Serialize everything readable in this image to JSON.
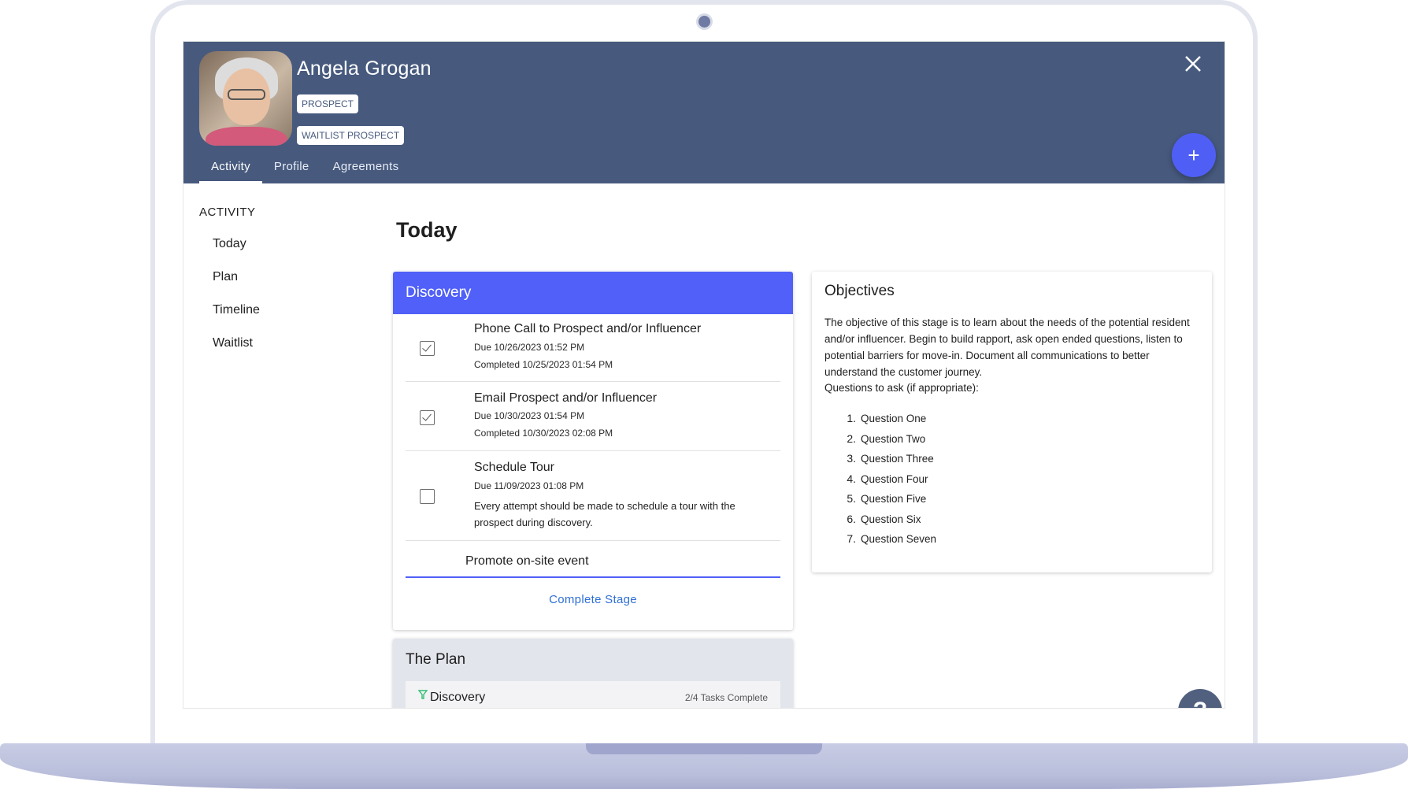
{
  "profile": {
    "name": "Angela Grogan",
    "badges": [
      "PROSPECT",
      "WAITLIST PROSPECT"
    ]
  },
  "tabs": [
    {
      "label": "Activity",
      "active": true
    },
    {
      "label": "Profile",
      "active": false
    },
    {
      "label": "Agreements",
      "active": false
    }
  ],
  "fab": {
    "icon": "plus-icon",
    "label": "+"
  },
  "sidebar": {
    "title": "ACTIVITY",
    "items": [
      "Today",
      "Plan",
      "Timeline",
      "Waitlist"
    ]
  },
  "main": {
    "title": "Today"
  },
  "discovery": {
    "title": "Discovery",
    "tasks": [
      {
        "title": "Phone Call to Prospect and/or Influencer",
        "due": "Due 10/26/2023 01:52 PM",
        "completed": "Completed 10/25/2023 01:54 PM",
        "checked": true
      },
      {
        "title": "Email Prospect and/or Influencer",
        "due": "Due 10/30/2023 01:54 PM",
        "completed": "Completed 10/30/2023 02:08 PM",
        "checked": true
      },
      {
        "title": "Schedule Tour",
        "due": "Due 11/09/2023 01:08 PM",
        "note": "Every attempt should be made to schedule a tour with the prospect during discovery.",
        "checked": false
      }
    ],
    "promote": "Promote on-site event",
    "complete_label": "Complete Stage"
  },
  "objectives": {
    "title": "Objectives",
    "text": "The objective of this stage is to learn about the needs of the potential resident and/or influencer. Begin to build rapport, ask open ended questions, listen to potential barriers for move-in. Document all communications to better understand the customer journey.",
    "ask": "Questions to ask (if appropriate):",
    "questions": [
      "Question One",
      "Question Two",
      "Question Three",
      "Question Four",
      "Question Five",
      "Question Six",
      "Question Seven"
    ]
  },
  "plan": {
    "title": "The Plan",
    "row_label": "Discovery",
    "row_count": "2/4 Tasks Complete"
  },
  "help": {
    "label": "?"
  },
  "colors": {
    "header": "#475a7e",
    "accent": "#5060f8",
    "link": "#2f6fd6"
  }
}
